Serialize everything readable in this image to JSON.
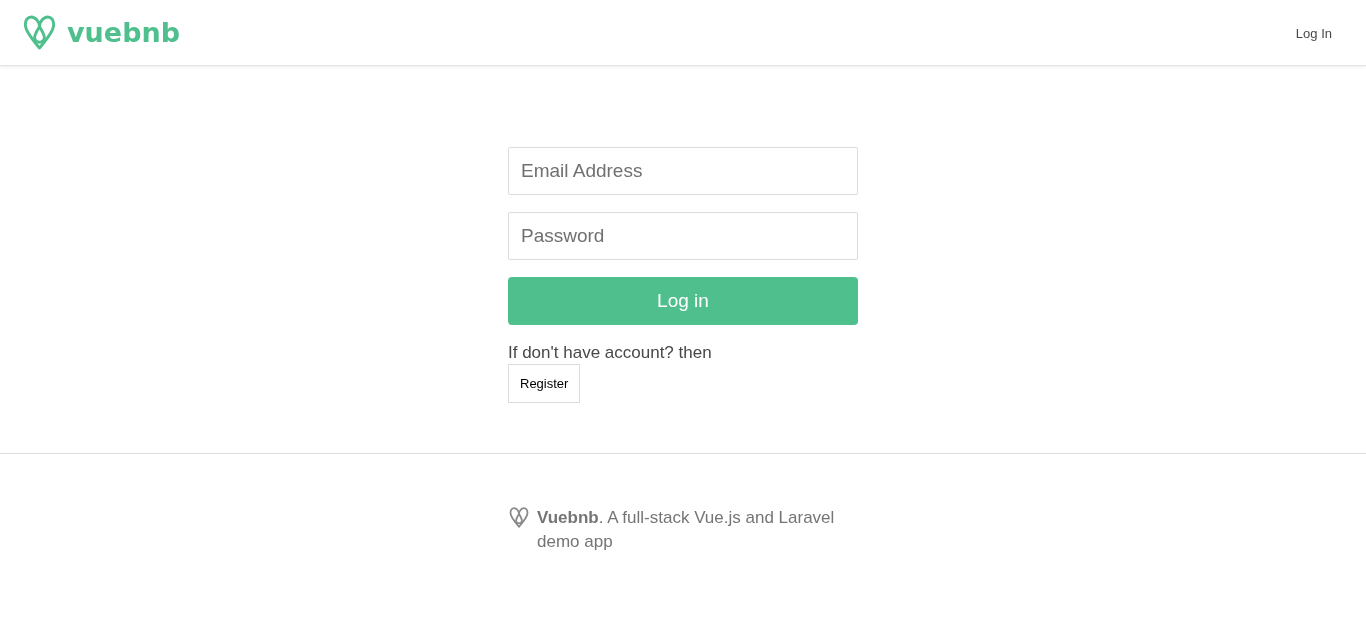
{
  "header": {
    "brand": "vuebnb",
    "nav_links": [
      "Log In"
    ]
  },
  "login_form": {
    "email_field": {
      "placeholder": "Email Address"
    },
    "password_field": {
      "placeholder": "Password"
    },
    "submit_button": "Log in",
    "register_prompt": "If don't have account? then",
    "register_button": "Register"
  },
  "footer": {
    "text": "**Vuebnb**. A full-stack Vue.js and Laravel demo app"
  }
}
